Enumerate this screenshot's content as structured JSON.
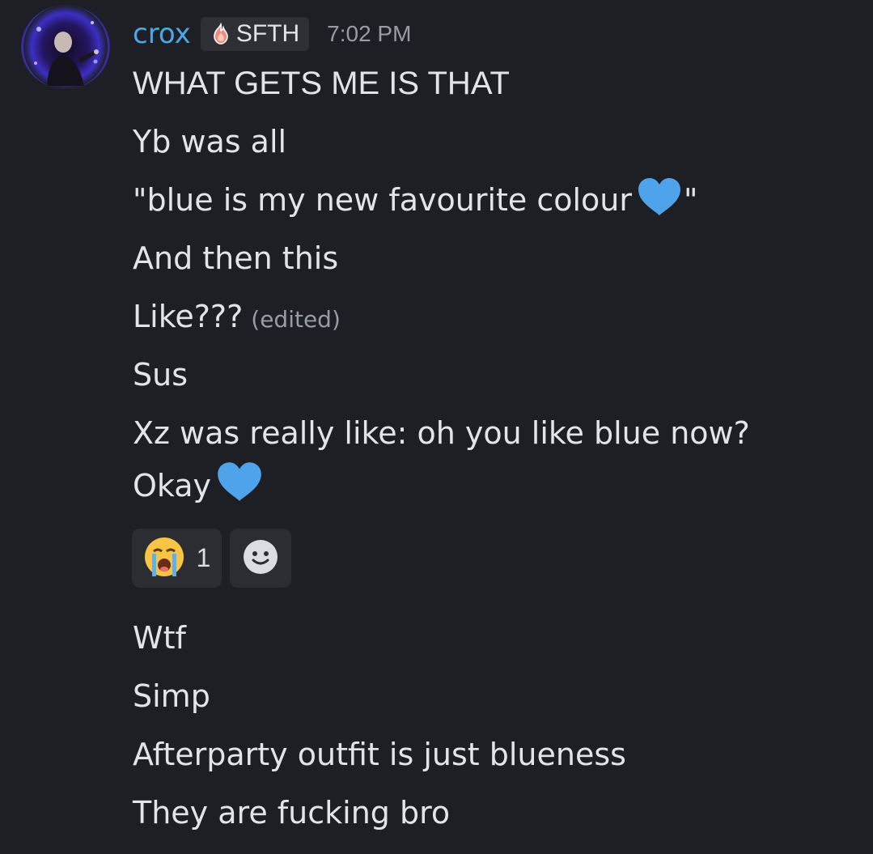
{
  "message": {
    "username": "crox",
    "tag": "SFTH",
    "timestamp": "7:02 PM",
    "colors": {
      "username": "#4aa8e8",
      "background": "#1e1f24",
      "heart": "#4fa3ea"
    },
    "lines": [
      {
        "text": "WHAT GETS ME IS THAT"
      },
      {
        "text": "Yb was all"
      },
      {
        "text": "\"blue is my new favourite colour",
        "emoji": "blue-heart",
        "after": "\""
      },
      {
        "text": "And then this"
      },
      {
        "text": "Like???",
        "edited": "(edited)"
      },
      {
        "text": "Sus"
      },
      {
        "text": "Xz was really like: oh you like blue now?"
      },
      {
        "text": "Okay",
        "emoji": "blue-heart"
      }
    ],
    "reactions": [
      {
        "emoji": "loudly-crying-face",
        "count": "1"
      },
      {
        "emoji": "add-reaction-smiley"
      }
    ],
    "more_lines": [
      {
        "text": "Wtf"
      },
      {
        "text": "Simp"
      },
      {
        "text": "Afterparty outfit is just blueness"
      },
      {
        "text": "They are fucking bro"
      }
    ]
  }
}
